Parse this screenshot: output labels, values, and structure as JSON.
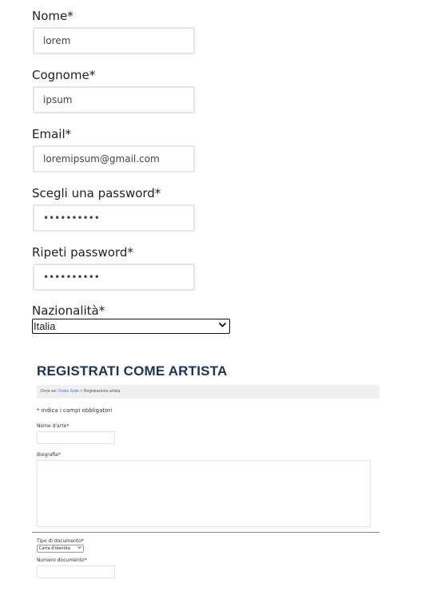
{
  "form": {
    "nome": {
      "label": "Nome*",
      "value": "lorem"
    },
    "cognome": {
      "label": "Cognome*",
      "value": "ipsum"
    },
    "email": {
      "label": "Email*",
      "value": "loremipsum@gmail.com"
    },
    "password": {
      "label": "Scegli una password*",
      "value": "••••••••••"
    },
    "repeat_password": {
      "label": "Ripeti password*",
      "value": "••••••••••"
    },
    "nazionalita": {
      "label": "Nazionalità*",
      "selected": "Italia"
    }
  },
  "artist_section": {
    "title": "REGISTRATI COME ARTISTA",
    "breadcrumb": {
      "prefix": "Dove sei:",
      "link": "Fedro Suite",
      "sep": ">",
      "current": "Registrazione artista"
    },
    "required_note": "* indica i campi obbligatori",
    "stage_name_label": "Nome d'arte*",
    "bio_label": "Biografia*",
    "doc_type_label": "Tipo di documento*",
    "doc_type_selected": "Carta d'identità",
    "doc_number_label": "Numero documento*"
  }
}
